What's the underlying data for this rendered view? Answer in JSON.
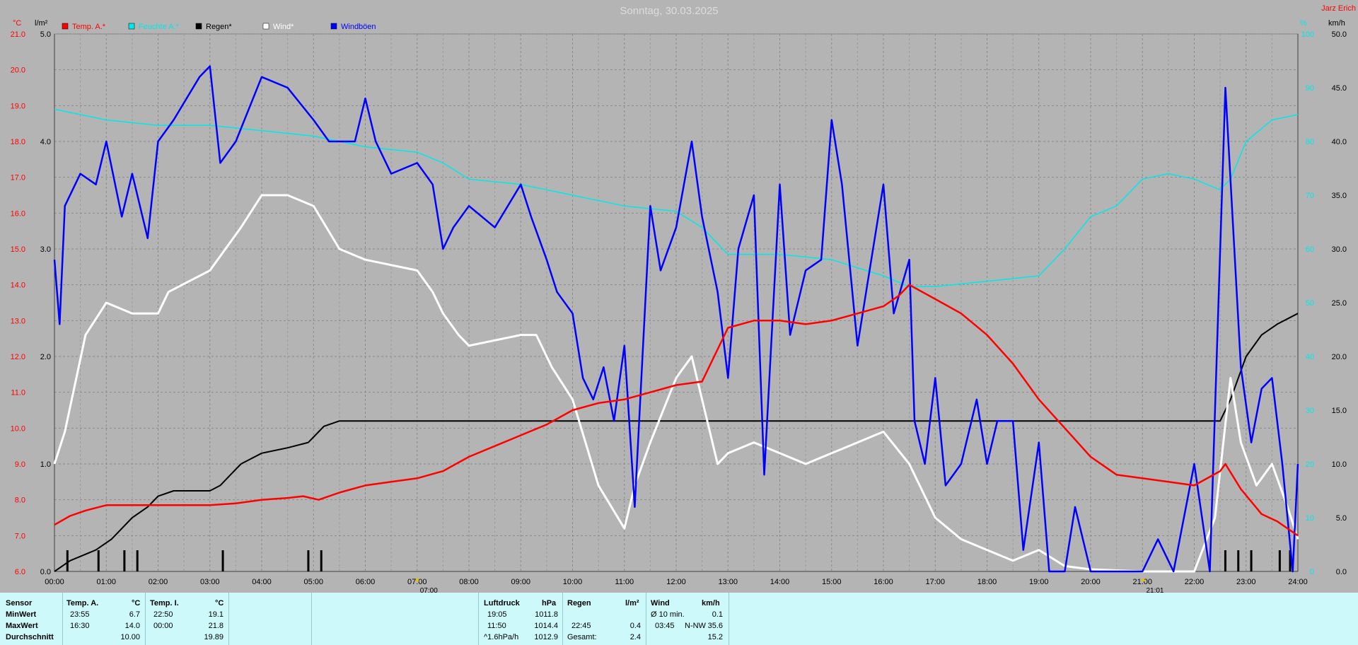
{
  "header": {
    "title": "Sonntag, 30.03.2025",
    "station": "Jarz Erich"
  },
  "axes": {
    "left1_unit": "°C",
    "left2_unit": "l/m²",
    "right1_unit": "%",
    "right2_unit": "km/h",
    "temp_ticks": [
      "21.0",
      "20.0",
      "19.0",
      "18.0",
      "17.0",
      "16.0",
      "15.0",
      "14.0",
      "13.0",
      "12.0",
      "11.0",
      "10.0",
      "9.0",
      "8.0",
      "7.0",
      "6.0"
    ],
    "rain_ticks": [
      "5.0",
      "4.0",
      "3.0",
      "2.0",
      "1.0",
      "0.0"
    ],
    "hum_ticks": [
      "100",
      "90",
      "80",
      "70",
      "60",
      "50",
      "40",
      "30",
      "20",
      "10",
      "0"
    ],
    "wind_ticks": [
      "50.0",
      "45.0",
      "40.0",
      "35.0",
      "30.0",
      "25.0",
      "20.0",
      "15.0",
      "10.0",
      "5.0",
      "0.0"
    ],
    "x_ticks": [
      "00:00",
      "01:00",
      "02:00",
      "03:00",
      "04:00",
      "05:00",
      "06:00",
      "07:00",
      "08:00",
      "09:00",
      "10:00",
      "11:00",
      "12:00",
      "13:00",
      "14:00",
      "15:00",
      "16:00",
      "17:00",
      "18:00",
      "19:00",
      "20:00",
      "21:00",
      "22:00",
      "23:00",
      "24:00"
    ],
    "sunrise_label": "07:00",
    "sunset_label": "21:01"
  },
  "legend": [
    {
      "label": "Temp. A.*",
      "color": "#ff0000"
    },
    {
      "label": "Feuchte A.*",
      "color": "#00e8e8"
    },
    {
      "label": "Regen*",
      "color": "#000000"
    },
    {
      "label": "Wind*",
      "color": "#ffffff"
    },
    {
      "label": "Windböen",
      "color": "#0000ff"
    }
  ],
  "chart_data": {
    "type": "line",
    "title": "Sonntag, 30.03.2025",
    "x_unit": "hour of day",
    "xlim": [
      0,
      24
    ],
    "grid": true,
    "legend_position": "top-left",
    "series": [
      {
        "name": "Temp. A.*",
        "axis": "temp",
        "unit": "°C",
        "ylim": [
          6,
          21
        ],
        "color": "#ff0000",
        "points": [
          [
            0,
            7.3
          ],
          [
            0.3,
            7.55
          ],
          [
            0.6,
            7.7
          ],
          [
            1,
            7.85
          ],
          [
            1.5,
            7.85
          ],
          [
            2,
            7.85
          ],
          [
            2.5,
            7.85
          ],
          [
            3,
            7.85
          ],
          [
            3.5,
            7.9
          ],
          [
            4,
            8.0
          ],
          [
            4.5,
            8.05
          ],
          [
            4.8,
            8.1
          ],
          [
            5.1,
            8.0
          ],
          [
            5.5,
            8.2
          ],
          [
            6,
            8.4
          ],
          [
            6.5,
            8.5
          ],
          [
            7,
            8.6
          ],
          [
            7.5,
            8.8
          ],
          [
            8,
            9.2
          ],
          [
            8.5,
            9.5
          ],
          [
            9,
            9.8
          ],
          [
            9.5,
            10.1
          ],
          [
            10,
            10.5
          ],
          [
            10.5,
            10.7
          ],
          [
            11,
            10.8
          ],
          [
            11.5,
            11.0
          ],
          [
            12,
            11.2
          ],
          [
            12.5,
            11.3
          ],
          [
            13,
            12.8
          ],
          [
            13.5,
            13.0
          ],
          [
            14,
            13.0
          ],
          [
            14.5,
            12.9
          ],
          [
            15,
            13.0
          ],
          [
            15.5,
            13.2
          ],
          [
            16,
            13.4
          ],
          [
            16.3,
            13.7
          ],
          [
            16.5,
            14.0
          ],
          [
            17,
            13.6
          ],
          [
            17.5,
            13.2
          ],
          [
            18,
            12.6
          ],
          [
            18.5,
            11.8
          ],
          [
            19,
            10.8
          ],
          [
            19.5,
            10.0
          ],
          [
            20,
            9.2
          ],
          [
            20.5,
            8.7
          ],
          [
            21,
            8.6
          ],
          [
            21.5,
            8.5
          ],
          [
            22,
            8.4
          ],
          [
            22.5,
            8.8
          ],
          [
            22.6,
            9.0
          ],
          [
            22.9,
            8.3
          ],
          [
            23.3,
            7.6
          ],
          [
            23.6,
            7.4
          ],
          [
            24,
            7.0
          ]
        ]
      },
      {
        "name": "Feuchte A.*",
        "axis": "hum",
        "unit": "%",
        "ylim": [
          0,
          100
        ],
        "color": "#00e8e8",
        "points": [
          [
            0,
            86
          ],
          [
            0.5,
            85
          ],
          [
            1,
            84
          ],
          [
            2,
            83
          ],
          [
            3,
            83
          ],
          [
            4,
            82
          ],
          [
            5,
            81
          ],
          [
            6,
            79
          ],
          [
            7,
            78
          ],
          [
            7.5,
            76
          ],
          [
            8,
            73
          ],
          [
            9,
            72
          ],
          [
            10,
            70
          ],
          [
            11,
            68
          ],
          [
            12,
            67
          ],
          [
            12.5,
            64
          ],
          [
            13,
            59
          ],
          [
            14,
            59
          ],
          [
            15,
            58
          ],
          [
            16,
            55
          ],
          [
            16.5,
            53
          ],
          [
            17,
            53
          ],
          [
            18,
            54
          ],
          [
            19,
            55
          ],
          [
            19.5,
            60
          ],
          [
            20,
            66
          ],
          [
            20.5,
            68
          ],
          [
            21,
            73
          ],
          [
            21.5,
            74
          ],
          [
            22,
            73
          ],
          [
            22.5,
            71
          ],
          [
            22.7,
            73
          ],
          [
            23,
            80
          ],
          [
            23.5,
            84
          ],
          [
            24,
            85
          ]
        ]
      },
      {
        "name": "Regen*",
        "axis": "rain",
        "unit": "l/m²",
        "ylim": [
          0,
          5
        ],
        "color": "#000000",
        "points": [
          [
            0,
            0
          ],
          [
            0.3,
            0.1
          ],
          [
            0.8,
            0.2
          ],
          [
            1.1,
            0.3
          ],
          [
            1.5,
            0.5
          ],
          [
            1.8,
            0.6
          ],
          [
            2,
            0.7
          ],
          [
            2.3,
            0.75
          ],
          [
            3,
            0.75
          ],
          [
            3.2,
            0.8
          ],
          [
            3.4,
            0.9
          ],
          [
            3.6,
            1.0
          ],
          [
            4,
            1.1
          ],
          [
            4.5,
            1.15
          ],
          [
            4.9,
            1.2
          ],
          [
            5,
            1.25
          ],
          [
            5.2,
            1.35
          ],
          [
            5.5,
            1.4
          ],
          [
            5.8,
            1.4
          ],
          [
            6,
            1.4
          ],
          [
            7,
            1.4
          ],
          [
            8,
            1.4
          ],
          [
            10,
            1.4
          ],
          [
            15,
            1.4
          ],
          [
            20,
            1.4
          ],
          [
            22.5,
            1.4
          ],
          [
            22.7,
            1.6
          ],
          [
            23,
            2.0
          ],
          [
            23.3,
            2.2
          ],
          [
            23.6,
            2.3
          ],
          [
            24,
            2.4
          ]
        ]
      },
      {
        "name": "Wind*",
        "axis": "wind",
        "unit": "km/h",
        "ylim": [
          0,
          50
        ],
        "color": "#ffffff",
        "points": [
          [
            0,
            10
          ],
          [
            0.2,
            13
          ],
          [
            0.6,
            22
          ],
          [
            1,
            25
          ],
          [
            1.5,
            24
          ],
          [
            2,
            24
          ],
          [
            2.2,
            26
          ],
          [
            3,
            28
          ],
          [
            3.3,
            30
          ],
          [
            3.6,
            32
          ],
          [
            4,
            35
          ],
          [
            4.5,
            35
          ],
          [
            5,
            34
          ],
          [
            5.5,
            30
          ],
          [
            6,
            29
          ],
          [
            7,
            28
          ],
          [
            7.3,
            26
          ],
          [
            7.5,
            24
          ],
          [
            7.8,
            22
          ],
          [
            8,
            21
          ],
          [
            9,
            22
          ],
          [
            9.3,
            22
          ],
          [
            9.6,
            19
          ],
          [
            10,
            16
          ],
          [
            10.5,
            8
          ],
          [
            11,
            4
          ],
          [
            11.2,
            8
          ],
          [
            11.5,
            12
          ],
          [
            12,
            18
          ],
          [
            12.3,
            20
          ],
          [
            12.5,
            16
          ],
          [
            12.8,
            10
          ],
          [
            13,
            11
          ],
          [
            13.5,
            12
          ],
          [
            14,
            11
          ],
          [
            14.5,
            10
          ],
          [
            15,
            11
          ],
          [
            15.5,
            12
          ],
          [
            16,
            13
          ],
          [
            16.5,
            10
          ],
          [
            16.8,
            7
          ],
          [
            17,
            5
          ],
          [
            17.5,
            3
          ],
          [
            18,
            2
          ],
          [
            18.5,
            1
          ],
          [
            19,
            2
          ],
          [
            19.5,
            0.5
          ],
          [
            20,
            0.2
          ],
          [
            21,
            0
          ],
          [
            22,
            0
          ],
          [
            22.4,
            5
          ],
          [
            22.7,
            18
          ],
          [
            22.9,
            12
          ],
          [
            23.2,
            8
          ],
          [
            23.5,
            10
          ],
          [
            23.8,
            6
          ],
          [
            24,
            3
          ]
        ]
      },
      {
        "name": "Windböen",
        "axis": "wind",
        "unit": "km/h",
        "ylim": [
          0,
          50
        ],
        "color": "#0000ff",
        "points": [
          [
            0,
            29
          ],
          [
            0.1,
            23
          ],
          [
            0.2,
            34
          ],
          [
            0.5,
            37
          ],
          [
            0.8,
            36
          ],
          [
            1,
            40
          ],
          [
            1.3,
            33
          ],
          [
            1.5,
            37
          ],
          [
            1.8,
            31
          ],
          [
            2,
            40
          ],
          [
            2.3,
            42
          ],
          [
            2.8,
            46
          ],
          [
            3,
            47
          ],
          [
            3.2,
            38
          ],
          [
            3.5,
            40
          ],
          [
            4,
            46
          ],
          [
            4.5,
            45
          ],
          [
            5,
            42
          ],
          [
            5.3,
            40
          ],
          [
            5.8,
            40
          ],
          [
            6,
            44
          ],
          [
            6.2,
            40
          ],
          [
            6.5,
            37
          ],
          [
            7,
            38
          ],
          [
            7.3,
            36
          ],
          [
            7.5,
            30
          ],
          [
            7.7,
            32
          ],
          [
            8,
            34
          ],
          [
            8.5,
            32
          ],
          [
            9,
            36
          ],
          [
            9.2,
            33
          ],
          [
            9.5,
            29
          ],
          [
            9.7,
            26
          ],
          [
            10,
            24
          ],
          [
            10.2,
            18
          ],
          [
            10.4,
            16
          ],
          [
            10.6,
            19
          ],
          [
            10.8,
            14
          ],
          [
            11,
            21
          ],
          [
            11.2,
            6
          ],
          [
            11.5,
            34
          ],
          [
            11.7,
            28
          ],
          [
            12,
            32
          ],
          [
            12.3,
            40
          ],
          [
            12.5,
            33
          ],
          [
            12.8,
            26
          ],
          [
            13,
            18
          ],
          [
            13.2,
            30
          ],
          [
            13.5,
            35
          ],
          [
            13.7,
            9
          ],
          [
            14,
            36
          ],
          [
            14.2,
            22
          ],
          [
            14.5,
            28
          ],
          [
            14.8,
            29
          ],
          [
            15,
            42
          ],
          [
            15.2,
            36
          ],
          [
            15.5,
            21
          ],
          [
            15.7,
            27
          ],
          [
            16,
            36
          ],
          [
            16.2,
            24
          ],
          [
            16.5,
            29
          ],
          [
            16.6,
            14
          ],
          [
            16.8,
            10
          ],
          [
            17,
            18
          ],
          [
            17.2,
            8
          ],
          [
            17.5,
            10
          ],
          [
            17.8,
            16
          ],
          [
            18,
            10
          ],
          [
            18.2,
            14
          ],
          [
            18.5,
            14
          ],
          [
            18.7,
            2
          ],
          [
            19,
            12
          ],
          [
            19.2,
            0
          ],
          [
            19.5,
            0
          ],
          [
            19.7,
            6
          ],
          [
            20,
            0
          ],
          [
            21,
            0
          ],
          [
            21.3,
            3
          ],
          [
            21.6,
            0
          ],
          [
            22,
            10
          ],
          [
            22.3,
            0
          ],
          [
            22.6,
            45
          ],
          [
            22.9,
            19
          ],
          [
            23.1,
            12
          ],
          [
            23.3,
            17
          ],
          [
            23.5,
            18
          ],
          [
            23.7,
            10
          ],
          [
            23.9,
            0
          ],
          [
            24,
            10
          ]
        ]
      }
    ],
    "rain_events": [
      0.25,
      0.85,
      1.35,
      1.6,
      3.25,
      4.9,
      5.15,
      22.6,
      22.85,
      23.1,
      23.65,
      23.85
    ]
  },
  "summary": {
    "row_labels": {
      "sensor": "Sensor",
      "min": "MinWert",
      "max": "MaxWert",
      "avg": "Durchschnitt"
    },
    "temp_a": {
      "title": "Temp. A.",
      "unit": "°C",
      "min_time": "23:55",
      "min_val": "6.7",
      "max_time": "16:30",
      "max_val": "14.0",
      "avg": "10.00"
    },
    "temp_i": {
      "title": "Temp. I.",
      "unit": "°C",
      "min_time": "22:50",
      "min_val": "19.1",
      "max_time": "00:00",
      "max_val": "21.8",
      "avg": "19.89"
    },
    "pressure": {
      "title": "Luftdruck",
      "unit": "hPa",
      "min_time": "19:05",
      "min_val": "1011.8",
      "max_time": "11:50",
      "max_val": "1014.4",
      "trend": "^1.6hPa/h",
      "trend_val": "1012.9"
    },
    "rain": {
      "title": "Regen",
      "unit": "l/m²",
      "max_time": "22:45",
      "max_val": "0.4",
      "total_label": "Gesamt:",
      "total_val": "2.4"
    },
    "wind": {
      "title": "Wind",
      "unit": "km/h",
      "avg_label": "Ø 10 min.",
      "avg_val": "0.1",
      "max_time": "03:45",
      "max_dir": "N-NW",
      "max_val": "35.6",
      "mean_val": "15.2"
    }
  }
}
